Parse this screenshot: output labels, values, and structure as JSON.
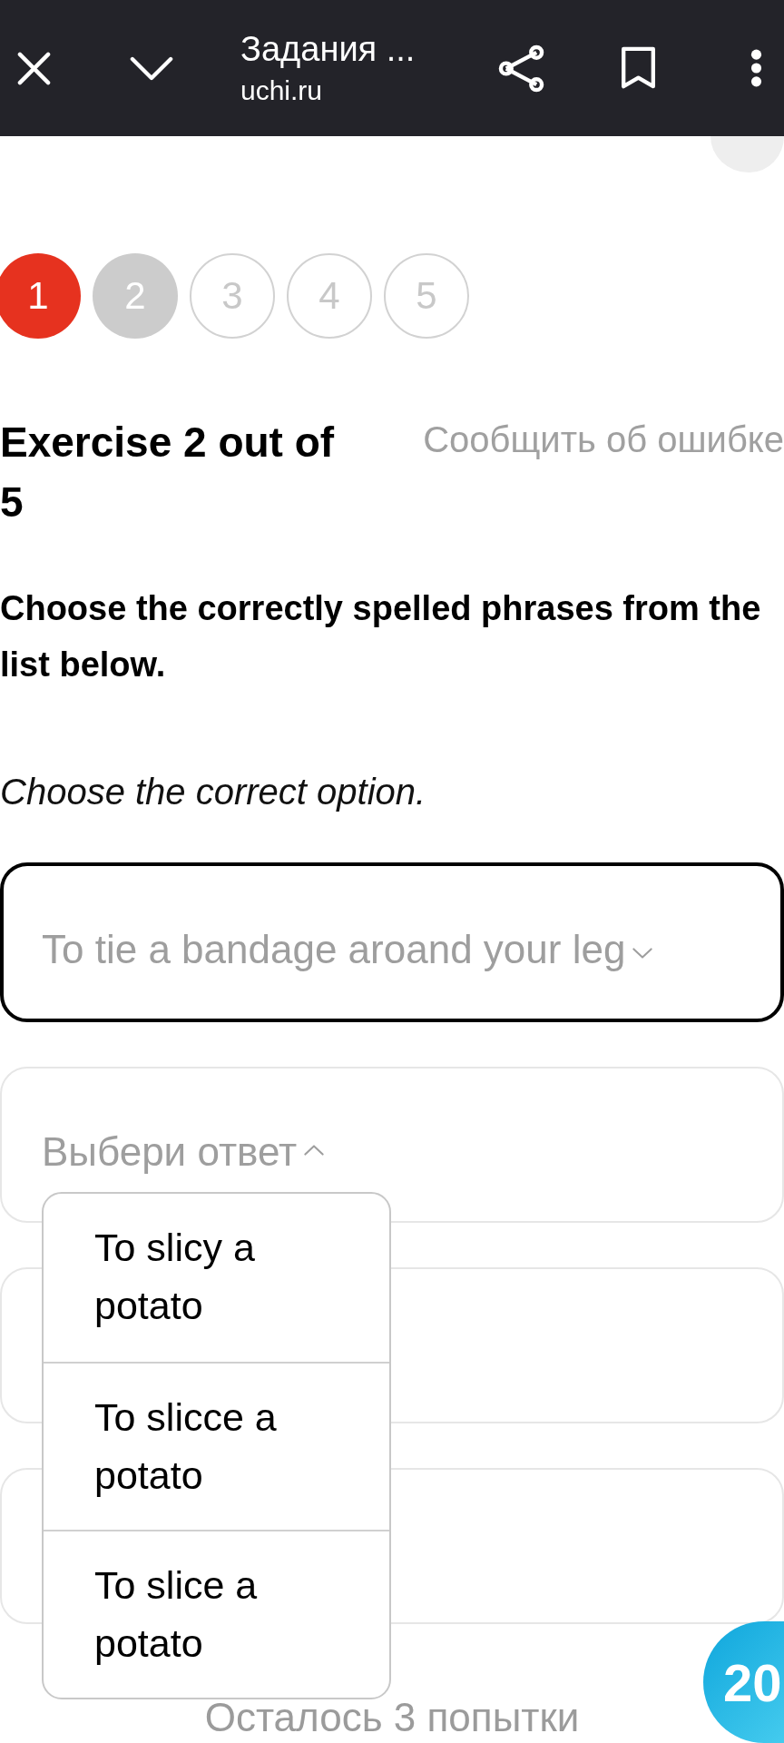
{
  "toolbar": {
    "title": "Задания ...",
    "url": "uchi.ru"
  },
  "steps": [
    {
      "label": "1",
      "kind": "failed"
    },
    {
      "label": "2",
      "kind": "current"
    },
    {
      "label": "3",
      "kind": "pending"
    },
    {
      "label": "4",
      "kind": "pending"
    },
    {
      "label": "5",
      "kind": "pending"
    }
  ],
  "exercise": {
    "title": "Exercise 2 out of 5",
    "report_link": "Сообщить об ошибке",
    "instruction": "Choose the correctly spelled phrases from the list below.",
    "hint": "Choose the correct option."
  },
  "answers": [
    {
      "value": "To tie a bandage aroand your leg",
      "focused": true,
      "expanded": false
    },
    {
      "placeholder": "Выбери ответ",
      "focused": false,
      "expanded": true,
      "options": [
        {
          "label": "To slicy a potato",
          "selected": false
        },
        {
          "label": "To slicce a potato",
          "selected": false
        },
        {
          "label": "To slice a potato",
          "selected": false
        }
      ]
    },
    {
      "focused": false
    },
    {
      "focused": false
    }
  ],
  "attempts_left": "Осталось 3 попытки",
  "timer": "20"
}
